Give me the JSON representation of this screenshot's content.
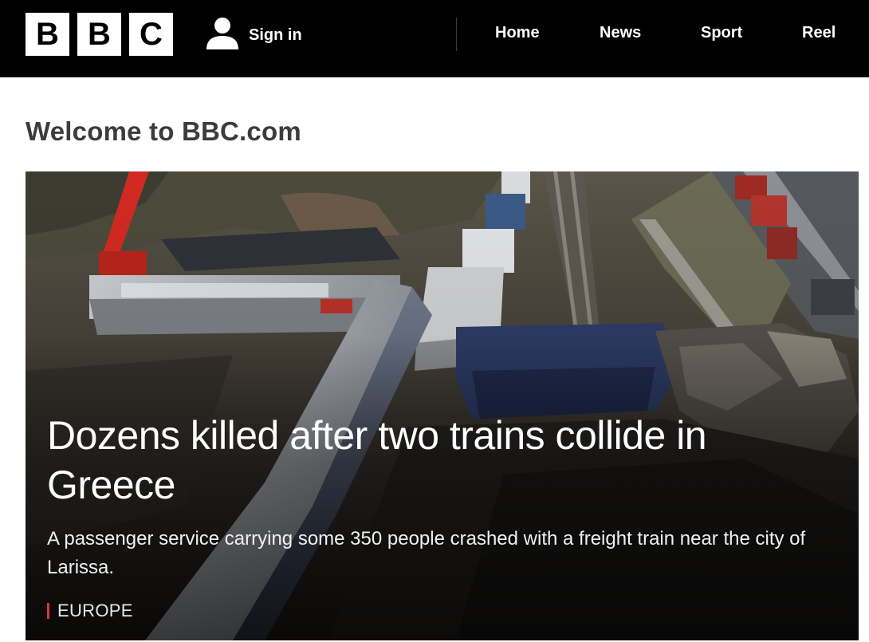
{
  "header": {
    "logo_letters": [
      "B",
      "B",
      "C"
    ],
    "sign_in_label": "Sign in",
    "sign_in_icon": "user-icon",
    "nav": [
      {
        "label": "Home"
      },
      {
        "label": "News"
      },
      {
        "label": "Sport"
      },
      {
        "label": "Reel"
      }
    ]
  },
  "welcome_title": "Welcome to BBC.com",
  "hero": {
    "headline": "Dozens killed after two trains collide in Greece",
    "summary": "A passenger service carrying some 350 people crashed with a freight train near the city of Larissa.",
    "tag": "EUROPE"
  },
  "colors": {
    "header_bg": "#000000",
    "logo_block": "#ffffff",
    "tag_accent": "#d6382e",
    "title_text": "#3c3c3c"
  }
}
